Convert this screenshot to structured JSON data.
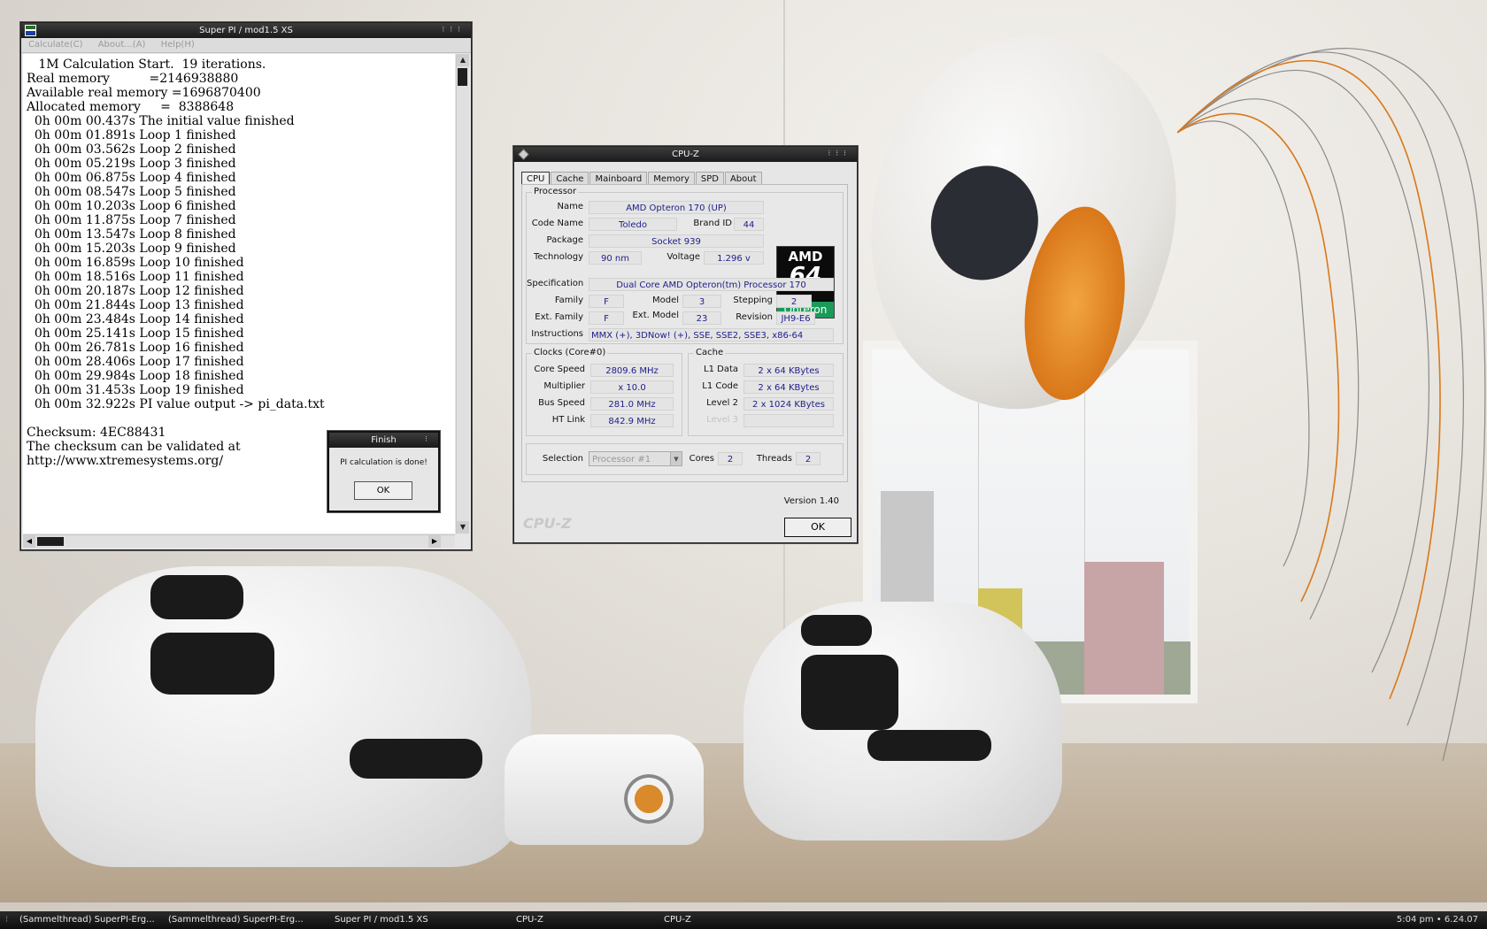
{
  "superpi": {
    "title": "Super PI / mod1.5 XS",
    "menu": [
      "Calculate(C)",
      "About...(A)",
      "Help(H)"
    ],
    "console_lines": [
      "   1M Calculation Start.  19 iterations.",
      "Real memory          =2146938880",
      "Available real memory =1696870400",
      "Allocated memory     =  8388648",
      "  0h 00m 00.437s The initial value finished",
      "  0h 00m 01.891s Loop 1 finished",
      "  0h 00m 03.562s Loop 2 finished",
      "  0h 00m 05.219s Loop 3 finished",
      "  0h 00m 06.875s Loop 4 finished",
      "  0h 00m 08.547s Loop 5 finished",
      "  0h 00m 10.203s Loop 6 finished",
      "  0h 00m 11.875s Loop 7 finished",
      "  0h 00m 13.547s Loop 8 finished",
      "  0h 00m 15.203s Loop 9 finished",
      "  0h 00m 16.859s Loop 10 finished",
      "  0h 00m 18.516s Loop 11 finished",
      "  0h 00m 20.187s Loop 12 finished",
      "  0h 00m 21.844s Loop 13 finished",
      "  0h 00m 23.484s Loop 14 finished",
      "  0h 00m 25.141s Loop 15 finished",
      "  0h 00m 26.781s Loop 16 finished",
      "  0h 00m 28.406s Loop 17 finished",
      "  0h 00m 29.984s Loop 18 finished",
      "  0h 00m 31.453s Loop 19 finished",
      "  0h 00m 32.922s PI value output -> pi_data.txt",
      "",
      "Checksum: 4EC88431",
      "The checksum can be validated at",
      "http://www.xtremesystems.org/"
    ]
  },
  "finish_dialog": {
    "title": "Finish",
    "message": "PI calculation is done!",
    "ok_label": "OK"
  },
  "cpuz": {
    "title": "CPU-Z",
    "tabs": [
      "CPU",
      "Cache",
      "Mainboard",
      "Memory",
      "SPD",
      "About"
    ],
    "processor": {
      "group_label": "Processor",
      "name_label": "Name",
      "name": "AMD Opteron 170 (UP)",
      "codename_label": "Code Name",
      "codename": "Toledo",
      "brandid_label": "Brand ID",
      "brandid": "44",
      "package_label": "Package",
      "package": "Socket 939",
      "technology_label": "Technology",
      "technology": "90 nm",
      "voltage_label": "Voltage",
      "voltage": "1.296 v",
      "spec_label": "Specification",
      "spec": "Dual Core AMD Opteron(tm) Processor 170",
      "family_label": "Family",
      "family": "F",
      "model_label": "Model",
      "model": "3",
      "stepping_label": "Stepping",
      "stepping": "2",
      "extfamily_label": "Ext. Family",
      "extfamily": "F",
      "extmodel_label": "Ext. Model",
      "extmodel": "23",
      "revision_label": "Revision",
      "revision": "JH9-E6",
      "instructions_label": "Instructions",
      "instructions": "MMX (+), 3DNow! (+), SSE, SSE2, SSE3, x86-64"
    },
    "logo": {
      "brand": "AMD",
      "number": "64",
      "line": "Opteron"
    },
    "clocks": {
      "group_label": "Clocks (Core#0)",
      "core_speed_label": "Core Speed",
      "core_speed": "2809.6 MHz",
      "multiplier_label": "Multiplier",
      "multiplier": "x 10.0",
      "bus_speed_label": "Bus Speed",
      "bus_speed": "281.0 MHz",
      "ht_link_label": "HT Link",
      "ht_link": "842.9 MHz"
    },
    "cache": {
      "group_label": "Cache",
      "l1data_label": "L1 Data",
      "l1data": "2 x 64 KBytes",
      "l1code_label": "L1 Code",
      "l1code": "2 x 64 KBytes",
      "level2_label": "Level 2",
      "level2": "2 x 1024 KBytes",
      "level3_label": "Level 3",
      "level3": ""
    },
    "selection_label": "Selection",
    "selection_value": "Processor #1",
    "cores_label": "Cores",
    "cores": "2",
    "threads_label": "Threads",
    "threads": "2",
    "version": "Version 1.40",
    "brand_watermark": "CPU-Z",
    "ok_label": "OK"
  },
  "taskbar": {
    "items": [
      "(Sammelthread) SuperPI-Erg...",
      "(Sammelthread) SuperPI-Erg...",
      "Super PI / mod1.5 XS",
      "CPU-Z",
      "CPU-Z"
    ],
    "clock": "5:04 pm • 6.24.07"
  }
}
